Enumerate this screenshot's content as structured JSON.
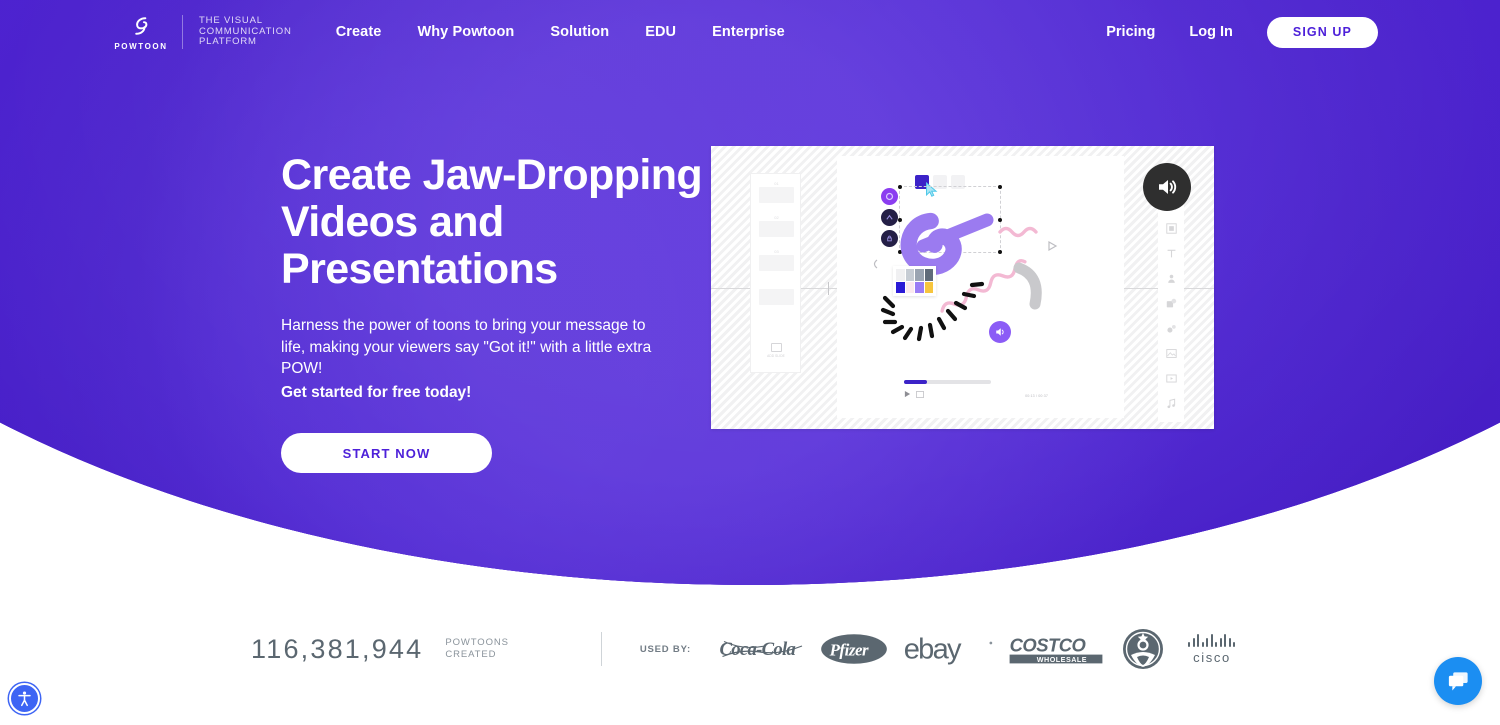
{
  "brand": {
    "logo_word": "Powtoon",
    "tagline_line1": "THE VISUAL",
    "tagline_line2": "COMMUNICATION",
    "tagline_line3": "PLATFORM",
    "purple": "#4d20d9",
    "white": "#ffffff"
  },
  "nav": {
    "items": [
      {
        "label": "Create"
      },
      {
        "label": "Why Powtoon"
      },
      {
        "label": "Solution"
      },
      {
        "label": "EDU"
      },
      {
        "label": "Enterprise"
      }
    ],
    "pricing_label": "Pricing",
    "login_label": "Log In",
    "signup_label": "SIGN UP"
  },
  "hero": {
    "title_line1": "Create Jaw-Dropping",
    "title_line2": "Videos and Presentations",
    "subtitle": "Harness the power of toons to bring your message to life, making your viewers say \"Got it!\" with a little extra POW!",
    "subtitle_bold": "Get started for free today!",
    "cta_label": "START NOW"
  },
  "video": {
    "sound_icon": "speaker-on-icon",
    "timecode": "00:13 / 00:37",
    "progress_percent": 26,
    "slide_numbers": [
      "01",
      "02",
      "03"
    ],
    "add_slide_label": "ADD SLIDE",
    "swatches": [
      "#2a1ad6",
      "#fbe9ef",
      "#9a7cf5",
      "#f7c53d",
      "#f0f0f2",
      "#c6ccd4",
      "#9aa4b2",
      "#5f6b7a"
    ],
    "rail_icons": [
      "layout-icon",
      "frame-icon",
      "text-icon",
      "character-icon",
      "shapes-icon",
      "props-icon",
      "image-icon",
      "video-icon",
      "music-icon"
    ]
  },
  "stats": {
    "count": "116,381,944",
    "count_label_line1": "POWTOONS",
    "count_label_line2": "CREATED",
    "used_by_label": "USED BY:",
    "brands": [
      {
        "name": "Coca-Cola",
        "icon": "coca-cola-logo"
      },
      {
        "name": "Pfizer",
        "icon": "pfizer-logo"
      },
      {
        "name": "ebay",
        "icon": "ebay-logo"
      },
      {
        "name": "Costco",
        "icon": "costco-logo",
        "sub": "WHOLESALE"
      },
      {
        "name": "Starbucks",
        "icon": "starbucks-logo"
      },
      {
        "name": "cisco",
        "icon": "cisco-logo"
      }
    ]
  },
  "widgets": {
    "accessibility_icon": "accessibility-icon",
    "chat_icon": "chat-bubble-icon"
  }
}
